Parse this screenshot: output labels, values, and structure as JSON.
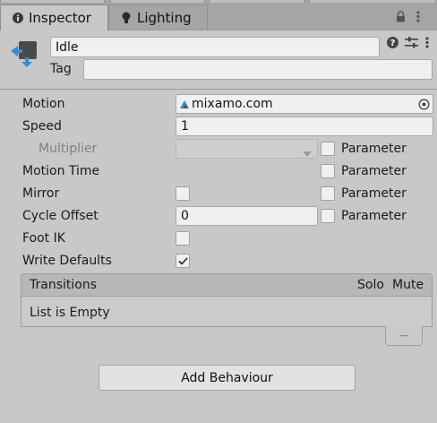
{
  "tabs": [
    {
      "label": "Inspector",
      "icon": "info-icon"
    },
    {
      "label": "Lighting",
      "icon": "lightbulb-icon"
    }
  ],
  "tab_actions": {
    "lock": "lock-icon",
    "menu": "more-vert-icon"
  },
  "header": {
    "name_value": "Idle",
    "tag_label": "Tag",
    "tag_value": "",
    "icons": [
      "help-icon",
      "presets-icon",
      "more-vert-icon"
    ]
  },
  "properties": {
    "motion": {
      "label": "Motion",
      "value": "mixamo.com"
    },
    "speed": {
      "label": "Speed",
      "value": "1"
    },
    "multiplier": {
      "label": "Multiplier",
      "value": "",
      "param_label": "Parameter"
    },
    "motion_time": {
      "label": "Motion Time",
      "param_label": "Parameter"
    },
    "mirror": {
      "label": "Mirror",
      "param_label": "Parameter"
    },
    "cycle_offset": {
      "label": "Cycle Offset",
      "value": "0",
      "param_label": "Parameter"
    },
    "foot_ik": {
      "label": "Foot IK",
      "checked": false
    },
    "write_defaults": {
      "label": "Write Defaults",
      "checked": true
    }
  },
  "transitions": {
    "header": "Transitions",
    "solo": "Solo",
    "mute": "Mute",
    "empty": "List is Empty",
    "remove_label": "−"
  },
  "add_behaviour": "Add Behaviour",
  "colors": {
    "accent": "#2f8fd6",
    "panel": "#c8c8c8",
    "field": "#f0f0f0"
  }
}
